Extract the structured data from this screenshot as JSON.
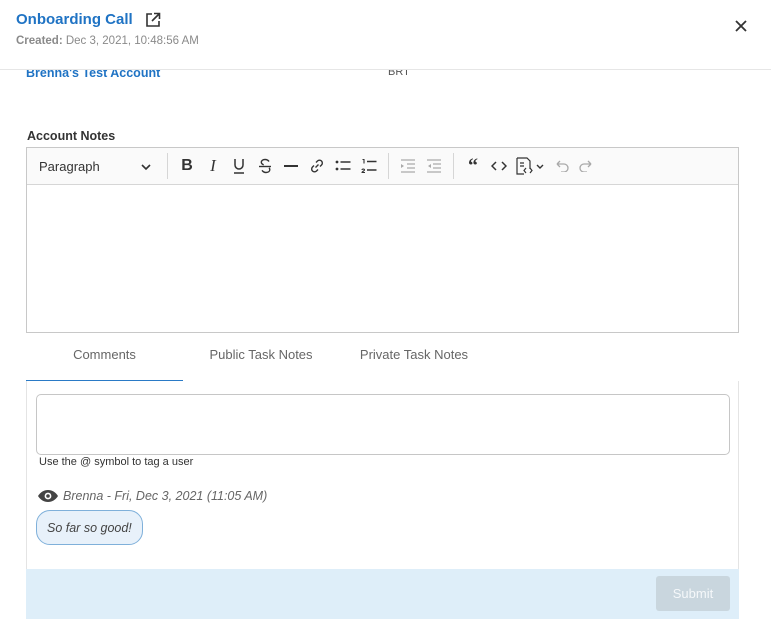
{
  "header": {
    "title": "Onboarding Call",
    "created_label": "Created:",
    "created_value": "Dec 3, 2021, 10:48:56 AM"
  },
  "account": {
    "name": "Brenna's Test Account",
    "code": "BRT"
  },
  "notes": {
    "label": "Account Notes",
    "toolbar": {
      "paragraph_select": "Paragraph",
      "buttons": [
        "bold-icon",
        "italic-icon",
        "underline-icon",
        "strikethrough-icon",
        "horizontal-line-icon",
        "link-icon",
        "bulleted-list-icon",
        "numbered-list-icon",
        "outdent-icon",
        "indent-icon",
        "block-quote-icon",
        "code-icon",
        "insert-template-icon",
        "undo-icon",
        "redo-icon"
      ]
    },
    "body": ""
  },
  "tabs": [
    {
      "label": "Comments",
      "active": true
    },
    {
      "label": "Public Task Notes",
      "active": false
    },
    {
      "label": "Private Task Notes",
      "active": false
    }
  ],
  "comments": {
    "input_value": "",
    "hint": "Use the @ symbol to tag a user",
    "items": [
      {
        "meta": "Brenna - Fri, Dec 3, 2021 (11:05 AM)",
        "text": "So far so good!"
      }
    ]
  },
  "footer": {
    "submit_label": "Submit"
  },
  "colors": {
    "accent": "#1f73c4",
    "tab_active": "#2a7ac6",
    "footer_bg": "#deeef9",
    "submit_disabled": "#c9d6de"
  }
}
